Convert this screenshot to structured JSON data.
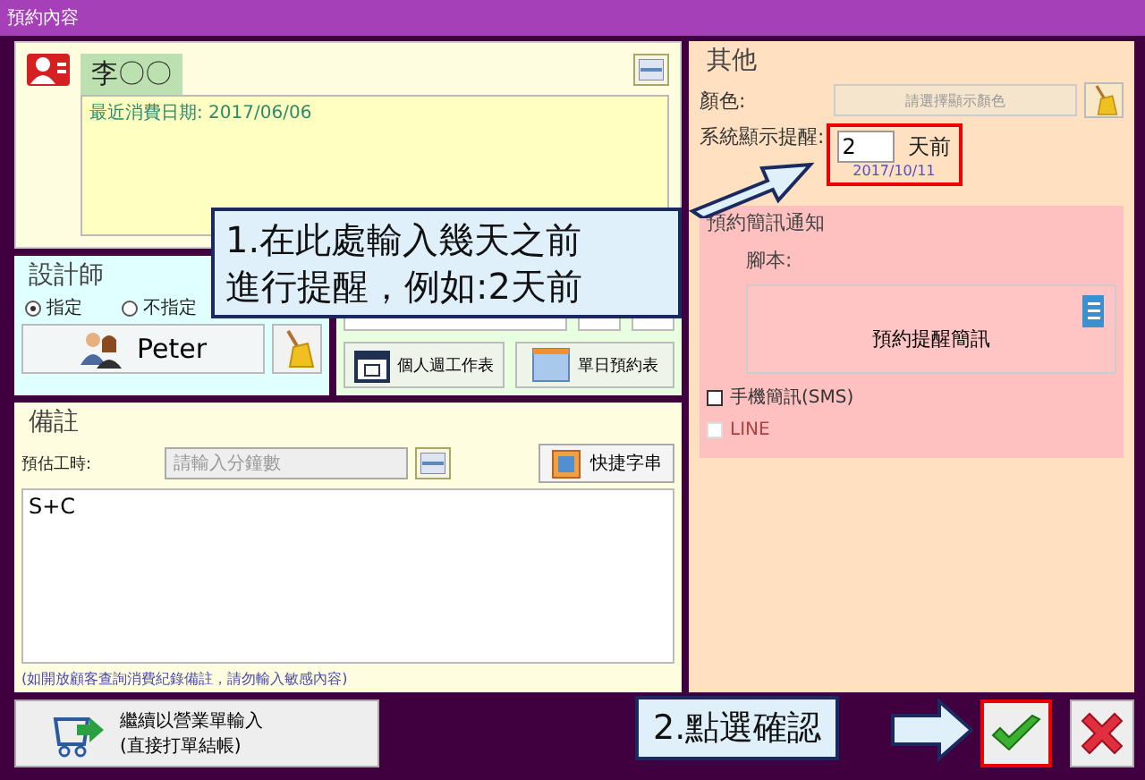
{
  "window": {
    "title": "預約內容"
  },
  "customer": {
    "name": "李〇〇",
    "note": "最近消費日期: 2017/06/06"
  },
  "designer": {
    "title": "設計師",
    "name": "Peter",
    "options": [
      {
        "label": "指定",
        "selected": true
      },
      {
        "label": "不指定",
        "selected": false
      }
    ]
  },
  "schedule_buttons": [
    {
      "label": "個人週工作表",
      "kind": "week"
    },
    {
      "label": "單日預約表",
      "kind": "day"
    }
  ],
  "remarks": {
    "title": "備註",
    "estimate_label": "預估工時:",
    "estimate_placeholder": "請輸入分鐘數",
    "shortcut_button": "快捷字串",
    "text": "S+C",
    "hint": "(如開放顧客查詢消費紀錄備註，請勿輸入敏感內容)"
  },
  "continue_button": {
    "line1": "繼續以營業單輸入",
    "line2": "(直接打單結帳)"
  },
  "other": {
    "title": "其他",
    "color_label": "顏色:",
    "color_placeholder": "請選擇顯示顏色",
    "reminder_label": "系統顯示提醒:",
    "reminder_days": "2",
    "reminder_unit": "天前",
    "reminder_date": "2017/10/11",
    "sms": {
      "title": "預約簡訊通知",
      "script_label": "腳本:",
      "script_button": "預約提醒簡訊",
      "channels": [
        {
          "label": "手機簡訊(SMS)",
          "checked": false,
          "disabled": false
        },
        {
          "label": "LINE",
          "checked": false,
          "disabled": true
        }
      ]
    }
  },
  "annotations": [
    {
      "lines": [
        "1.在此處輸入幾天之前",
        "進行提醒，例如:2天前"
      ]
    },
    {
      "lines": [
        "2.點選確認"
      ]
    }
  ]
}
